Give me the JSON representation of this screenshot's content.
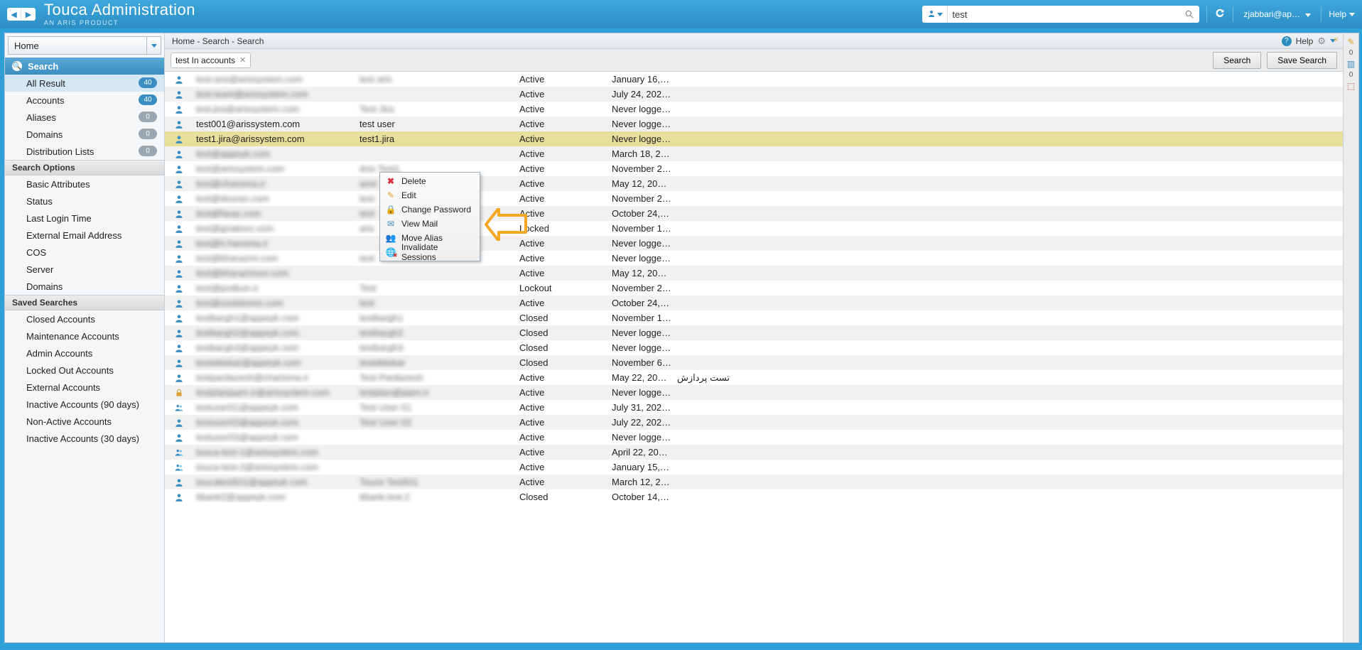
{
  "banner": {
    "title": "Touca Administration",
    "subtitle": "AN ARIS PRODUCT",
    "search_value": "test",
    "user": "zjabbari@ap…",
    "help": "Help"
  },
  "crumb": "Home - Search - Search",
  "crumb_help": "Help",
  "toolbar": {
    "chip": "test In accounts",
    "search_btn": "Search",
    "save_btn": "Save Search"
  },
  "sidebar": {
    "home": "Home",
    "search_head": "Search",
    "cats": [
      {
        "label": "All Result",
        "count": "40",
        "blue": true,
        "sel": true
      },
      {
        "label": "Accounts",
        "count": "40",
        "blue": true
      },
      {
        "label": "Aliases",
        "count": "0"
      },
      {
        "label": "Domains",
        "count": "0"
      },
      {
        "label": "Distribution Lists",
        "count": "0"
      }
    ],
    "options_head": "Search Options",
    "options": [
      "Basic Attributes",
      "Status",
      "Last Login Time",
      "External Email Address",
      "COS",
      "Server",
      "Domains"
    ],
    "saved_head": "Saved Searches",
    "saved": [
      "Closed Accounts",
      "Maintenance Accounts",
      "Admin Accounts",
      "Locked Out Accounts",
      "External Accounts",
      "Inactive Accounts (90 days)",
      "Non-Active Accounts",
      "Inactive Accounts (30 days)"
    ]
  },
  "context_menu": {
    "items": [
      {
        "label": "Delete",
        "icon": "delete"
      },
      {
        "label": "Edit",
        "icon": "edit"
      },
      {
        "label": "Change Password",
        "icon": "lock"
      },
      {
        "label": "View Mail",
        "icon": "mail"
      },
      {
        "label": "Move Alias",
        "icon": "alias"
      },
      {
        "label": "Invalidate Sessions",
        "icon": "invalidate"
      }
    ]
  },
  "east": {
    "count1": "0",
    "count2": "0"
  },
  "rows": [
    {
      "icon": "user",
      "email": "test-aris@arissystem.com",
      "name": "test aris",
      "status": "Active",
      "last": "January 16, 20…",
      "desc": "",
      "blur": true
    },
    {
      "icon": "user",
      "email": "test-team@arissystem.com",
      "name": "",
      "status": "Active",
      "last": "July 24, 2024 …",
      "desc": "",
      "blur": true
    },
    {
      "icon": "user",
      "email": "test.jira@arissystem.com",
      "name": "Test Jira",
      "status": "Active",
      "last": "Never logged In",
      "desc": "",
      "blur": true
    },
    {
      "icon": "user",
      "email": "test001@arissystem.com",
      "name": "test user",
      "status": "Active",
      "last": "Never logged In",
      "desc": "",
      "blur": false
    },
    {
      "icon": "user",
      "email": "test1.jira@arissystem.com",
      "name": "test1.jira",
      "status": "Active",
      "last": "Never logged In",
      "desc": "",
      "sel": true
    },
    {
      "icon": "user",
      "email": "test@appeyk.com",
      "name": "",
      "status": "Active",
      "last": "March 18, 202…",
      "desc": "",
      "blur": true
    },
    {
      "icon": "user",
      "email": "test@arissystem.com",
      "name": "Aris Test1",
      "status": "Active",
      "last": "November 2, 2…",
      "desc": "",
      "blur": true
    },
    {
      "icon": "user",
      "email": "test@charisma.ir",
      "name": "amir",
      "status": "Active",
      "last": "May 12, 2023 …",
      "desc": "",
      "blur": true
    },
    {
      "icon": "user",
      "email": "test@douran.com",
      "name": "test",
      "status": "Active",
      "last": "November 29, …",
      "desc": "",
      "blur": true
    },
    {
      "icon": "user",
      "email": "test@faraz.com",
      "name": "test",
      "status": "Active",
      "last": "October 24, 2…",
      "desc": "",
      "blur": true
    },
    {
      "icon": "user",
      "email": "test@gnaborz.com",
      "name": "aris",
      "status": "Locked",
      "last": "November 17, …",
      "desc": "",
      "blur": true
    },
    {
      "icon": "user",
      "email": "test@ir.hansma.ir",
      "name": "",
      "status": "Active",
      "last": "Never logged In",
      "desc": "",
      "blur": true
    },
    {
      "icon": "user",
      "email": "test@kharazmi.com",
      "name": "test",
      "status": "Active",
      "last": "Never logged In",
      "desc": "",
      "blur": true
    },
    {
      "icon": "user",
      "email": "test@kharazmoor.com",
      "name": "",
      "status": "Active",
      "last": "May 12, 2023 …",
      "desc": "",
      "blur": true
    },
    {
      "icon": "user",
      "email": "test@podium.ir",
      "name": "Test",
      "status": "Lockout",
      "last": "November 29, …",
      "desc": "",
      "blur": true
    },
    {
      "icon": "user",
      "email": "test@zootstores.com",
      "name": "test",
      "status": "Active",
      "last": "October 24, 2…",
      "desc": "",
      "blur": true
    },
    {
      "icon": "user",
      "email": "testbargh1@appeyk.com",
      "name": "testbargh1",
      "status": "Closed",
      "last": "November 17, …",
      "desc": "",
      "blur": true
    },
    {
      "icon": "user",
      "email": "testbargh2@appeyk.com",
      "name": "testbargh2",
      "status": "Closed",
      "last": "Never logged In",
      "desc": "",
      "blur": true
    },
    {
      "icon": "user",
      "email": "testbargh3@appeyk.com",
      "name": "testbargh3",
      "status": "Closed",
      "last": "Never logged In",
      "desc": "",
      "blur": true
    },
    {
      "icon": "user",
      "email": "testebtekar@appeyk.com",
      "name": "testebtekar",
      "status": "Closed",
      "last": "November 6, 2…",
      "desc": "",
      "blur": true
    },
    {
      "icon": "user",
      "email": "testpardazesh@charisma.ir",
      "name": "Test Pardazesh",
      "status": "Active",
      "last": "May 22, 2023 …",
      "desc": "تست پردازش",
      "blur": true
    },
    {
      "icon": "lock",
      "email": "testplanjaam.ir@arissystem.com",
      "name": "testplan@jaam.ir",
      "status": "Active",
      "last": "Never logged In",
      "desc": "",
      "blur": true
    },
    {
      "icon": "group",
      "email": "testuser01@appeyk.com",
      "name": "Test User 01",
      "status": "Active",
      "last": "July 31, 2024 …",
      "desc": "",
      "blur": true
    },
    {
      "icon": "user",
      "email": "testuser02@appeyk.com",
      "name": "Test User 02",
      "status": "Active",
      "last": "July 22, 2024 …",
      "desc": "",
      "blur": true
    },
    {
      "icon": "user",
      "email": "testuser03@appeyk.com",
      "name": "",
      "status": "Active",
      "last": "Never logged In",
      "desc": "",
      "blur": true
    },
    {
      "icon": "group",
      "email": "touca-test-1@arissystem.com",
      "name": "",
      "status": "Active",
      "last": "April 22, 2024 …",
      "desc": "",
      "blur": true
    },
    {
      "icon": "group",
      "email": "touca-test-2@arissystem.com",
      "name": "",
      "status": "Active",
      "last": "January 15, 20…",
      "desc": "",
      "blur": true
    },
    {
      "icon": "user",
      "email": "toucatest911@appeyk.com",
      "name": "Touce Test911",
      "status": "Active",
      "last": "March 12, 202…",
      "desc": "",
      "blur": true
    },
    {
      "icon": "user",
      "email": "ttbank2@appeyk.com",
      "name": "ttbank.test.2",
      "status": "Closed",
      "last": "October 14, 2…",
      "desc": "",
      "blur": true
    }
  ]
}
